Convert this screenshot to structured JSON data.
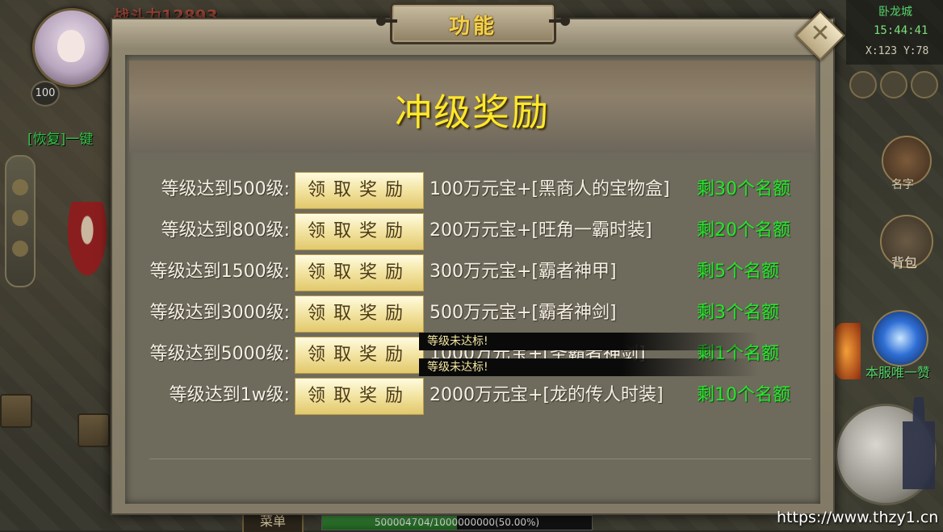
{
  "hud": {
    "power": "战斗力12893",
    "level": "100",
    "restore_text": "[恢复]一键",
    "city": "卧龙城",
    "time": "15:44:41",
    "coords": "X:123 Y:78",
    "name_btn": "名字",
    "bag_btn": "背包",
    "server_text": "本服唯一赞",
    "menu_tag": "菜单",
    "exp_text": "500004704/1000000000(50.00%)",
    "exp_fraction": 0.5
  },
  "dialog": {
    "title": "功能",
    "banner": "冲级奖励",
    "close_icon": "close-icon",
    "rows": [
      {
        "level": "等级达到500级:",
        "button": "领取奖励",
        "reward": "100万元宝+[黑商人的宝物盒]",
        "quota": "剩30个名额"
      },
      {
        "level": "等级达到800级:",
        "button": "领取奖励",
        "reward": "200万元宝+[旺角一霸时装]",
        "quota": "剩20个名额"
      },
      {
        "level": "等级达到1500级:",
        "button": "领取奖励",
        "reward": "300万元宝+[霸者神甲]",
        "quota": "剩5个名额"
      },
      {
        "level": "等级达到3000级:",
        "button": "领取奖励",
        "reward": "500万元宝+[霸者神剑]",
        "quota": "剩3个名额"
      },
      {
        "level": "等级达到5000级:",
        "button": "领取奖励",
        "reward": "1000万元宝+[圣霸者神剑]",
        "quota": "剩1个名额"
      },
      {
        "level": "等级达到1w级:",
        "button": "领取奖励",
        "reward": "2000万元宝+[龙的传人时装]",
        "quota": "剩10个名额"
      }
    ],
    "toasts": [
      "等级未达标!",
      "等级未达标!"
    ]
  },
  "watermark": "https://www.thzy1.cn"
}
